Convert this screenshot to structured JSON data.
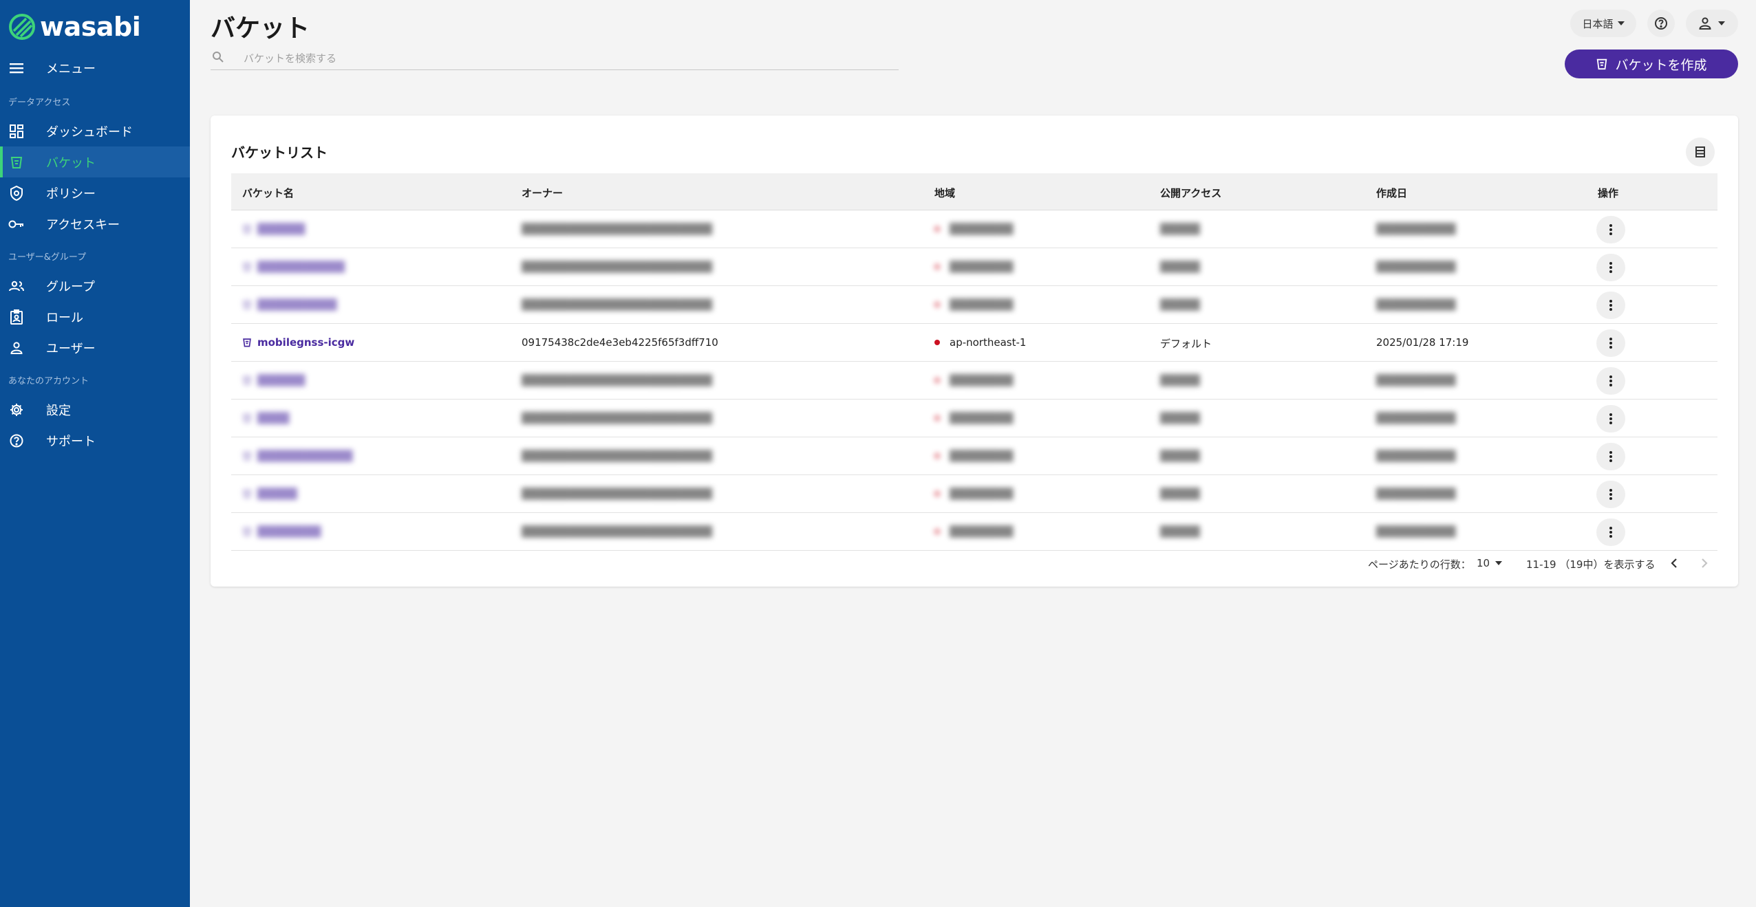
{
  "app": {
    "logo_text": "wasabi",
    "page_title": "バケット"
  },
  "sidebar": {
    "menu_label": "メニュー",
    "sections": [
      "データアクセス",
      "ユーザー&グループ",
      "あなたのアカウント"
    ],
    "items": [
      {
        "label": "ダッシュボード",
        "icon": "dashboard-icon"
      },
      {
        "label": "バケット",
        "icon": "bucket-icon",
        "active": true
      },
      {
        "label": "ポリシー",
        "icon": "shield-icon"
      },
      {
        "label": "アクセスキー",
        "icon": "key-icon"
      },
      {
        "label": "グループ",
        "icon": "group-icon"
      },
      {
        "label": "ロール",
        "icon": "role-badge-icon"
      },
      {
        "label": "ユーザー",
        "icon": "user-icon"
      },
      {
        "label": "設定",
        "icon": "gear-icon"
      },
      {
        "label": "サポート",
        "icon": "help-circle-icon"
      }
    ]
  },
  "header": {
    "search_placeholder": "バケットを検索する",
    "language": "日本語",
    "create_button": "バケットを作成"
  },
  "colors": {
    "sidebar_bg": "#0a4f96",
    "accent_green": "#3dd37a",
    "primary_purple": "#4a2ba0",
    "region_dot": "#cc1122"
  },
  "table": {
    "title": "バケットリスト",
    "columns": [
      "バケット名",
      "オーナー",
      "地域",
      "公開アクセス",
      "作成日",
      "操作"
    ],
    "rows": [
      {
        "name": "██████",
        "owner": "████████████████████████",
        "region": "████████",
        "access": "█████",
        "created": "██████████",
        "blurred": true
      },
      {
        "name": "███████████",
        "owner": "████████████████████████",
        "region": "████████",
        "access": "█████",
        "created": "██████████",
        "blurred": true
      },
      {
        "name": "██████████",
        "owner": "████████████████████████",
        "region": "████████",
        "access": "█████",
        "created": "██████████",
        "blurred": true
      },
      {
        "name": "mobilegnss-icgw",
        "owner": "09175438c2de4e3eb4225f65f3dff710",
        "region": "ap-northeast-1",
        "access": "デフォルト",
        "created": "2025/01/28 17:19",
        "blurred": false
      },
      {
        "name": "██████",
        "owner": "████████████████████████",
        "region": "████████",
        "access": "█████",
        "created": "██████████",
        "blurred": true
      },
      {
        "name": "████",
        "owner": "████████████████████████",
        "region": "████████",
        "access": "█████",
        "created": "██████████",
        "blurred": true
      },
      {
        "name": "████████████",
        "owner": "████████████████████████",
        "region": "████████",
        "access": "█████",
        "created": "██████████",
        "blurred": true
      },
      {
        "name": "█████",
        "owner": "████████████████████████",
        "region": "████████",
        "access": "█████",
        "created": "██████████",
        "blurred": true
      },
      {
        "name": "████████",
        "owner": "████████████████████████",
        "region": "████████",
        "access": "█████",
        "created": "██████████",
        "blurred": true
      }
    ]
  },
  "pagination": {
    "rows_per_page_label": "ページあたりの行数：",
    "rows_per_page": "10",
    "range_text": "11-19 （19中）を表示する"
  }
}
